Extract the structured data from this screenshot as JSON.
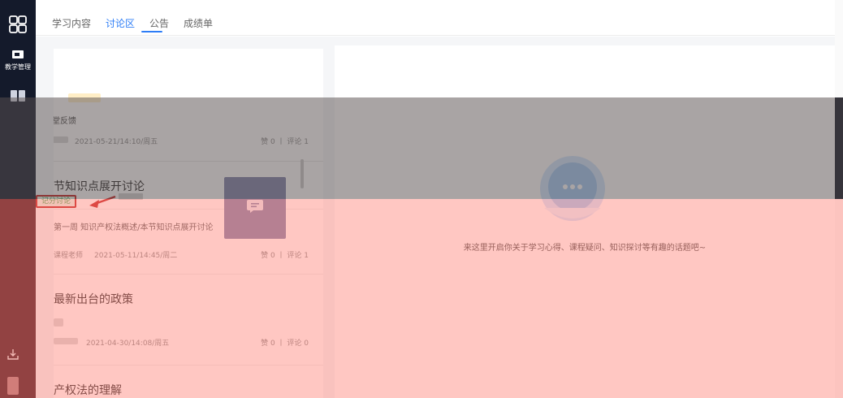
{
  "rail": {
    "item_label": "教学管理"
  },
  "tabs": [
    {
      "label": "学习内容"
    },
    {
      "label": "讨论区",
      "active": true
    },
    {
      "label": "公告"
    },
    {
      "label": "成绩单"
    }
  ],
  "list": [
    {
      "title": "课堂反馈",
      "meta": "2021-05-21/14:10/周五",
      "stats": "赞 0 丨 评论 1"
    },
    {
      "title": "本节知识点展开讨论",
      "tag": "记分讨论",
      "subtitle": "第一周 知识产权法概述/本节知识点展开讨论",
      "author": "课程老师",
      "meta": "2021-05-11/14:45/周二",
      "stats": "赞 0 丨 评论 1"
    },
    {
      "title": "最新出台的政策",
      "meta": "2021-04-30/14:08/周五",
      "stats": "赞 0 丨 评论 0"
    },
    {
      "title": "产权法的理解"
    }
  ],
  "empty_state": {
    "text": "来这里开启你关于学习心得、课程疑问、知识探讨等有趣的话题吧~"
  }
}
